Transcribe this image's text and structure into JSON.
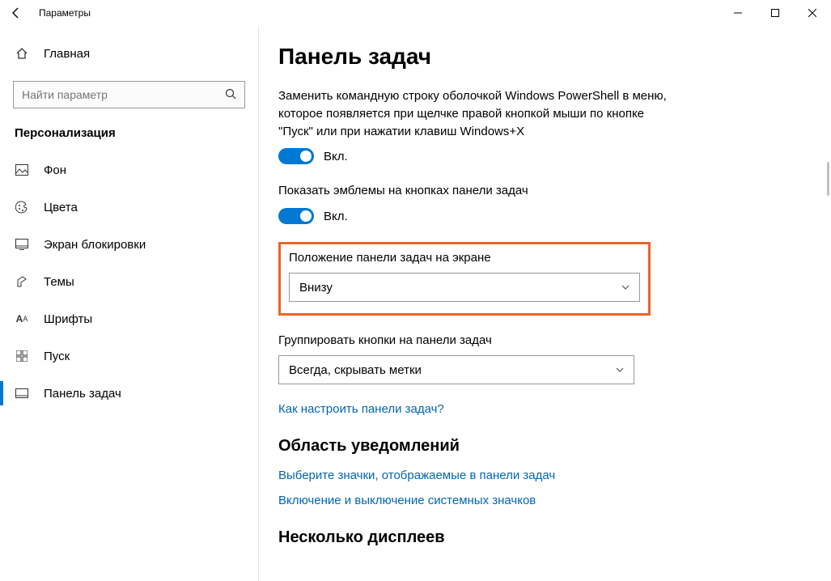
{
  "window": {
    "title": "Параметры"
  },
  "sidebar": {
    "home": "Главная",
    "search_placeholder": "Найти параметр",
    "section": "Персонализация",
    "items": [
      {
        "label": "Фон"
      },
      {
        "label": "Цвета"
      },
      {
        "label": "Экран блокировки"
      },
      {
        "label": "Темы"
      },
      {
        "label": "Шрифты"
      },
      {
        "label": "Пуск"
      },
      {
        "label": "Панель задач"
      }
    ]
  },
  "main": {
    "title": "Панель задач",
    "powershell_desc": "Заменить командную строку оболочкой Windows PowerShell в меню, которое появляется при щелчке правой кнопкой мыши по кнопке \"Пуск\" или при нажатии клавиш Windows+X",
    "on_label": "Вкл.",
    "badges_desc": "Показать эмблемы на кнопках панели задач",
    "position_label": "Положение панели задач на экране",
    "position_value": "Внизу",
    "group_label": "Группировать кнопки на панели задач",
    "group_value": "Всегда, скрывать метки",
    "help_link": "Как настроить панели задач?",
    "notif_heading": "Область уведомлений",
    "link_icons": "Выберите значки, отображаемые в панели задач",
    "link_system_icons": "Включение и выключение системных значков",
    "multi_heading": "Несколько дисплеев"
  }
}
